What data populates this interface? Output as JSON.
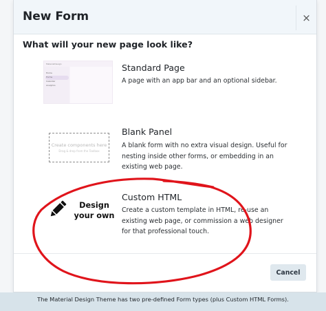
{
  "dialog": {
    "title": "New Form",
    "close_glyph": "×",
    "question": "What will your new page look like?",
    "options": [
      {
        "title": "Standard Page",
        "description": "A page with an app bar and an optional sidebar.",
        "thumbnail": {
          "app_title": "MaterialDesign",
          "menu_items": [
            "Home",
            "Forms",
            "Calendar",
            "Analytics"
          ]
        }
      },
      {
        "title": "Blank Panel",
        "description": "A blank form with no extra visual design. Useful for nesting inside other forms, or embedding in an existing web page.",
        "thumbnail": {
          "line1": "Create components here",
          "line2": "Drag & drop from the Toolbox"
        }
      },
      {
        "title": "Custom HTML",
        "description": "Create a custom template in HTML, re-use an existing web page, or commission a web designer for that professional touch.",
        "thumbnail": {
          "label_line1": "Design",
          "label_line2": "your own",
          "icon": "pencil-icon"
        }
      }
    ],
    "cancel_label": "Cancel"
  },
  "caption": "The Material Design Theme has two pre-defined Form types (plus Custom HTML Forms).",
  "colors": {
    "header_bg": "#f1f6fa",
    "cancel_bg": "#dfe8ee",
    "caption_bg": "#d7e3ea",
    "annotation_red": "#e0141b"
  }
}
